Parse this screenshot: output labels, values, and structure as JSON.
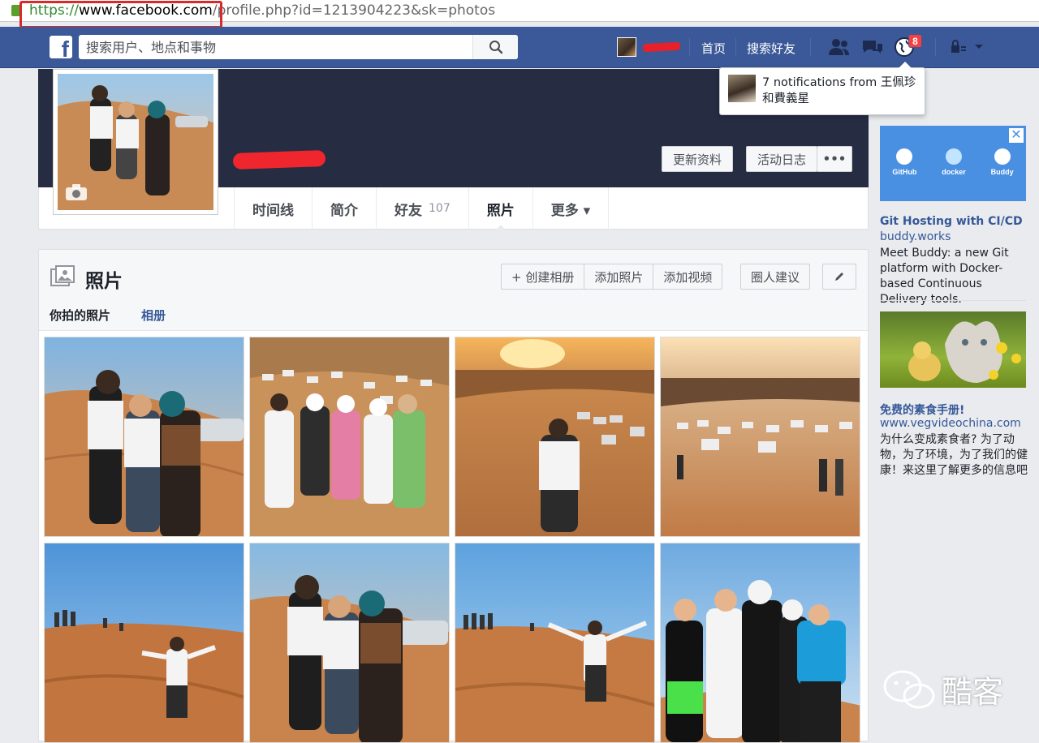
{
  "browser": {
    "url_protocol": "https://",
    "url_domain": "www.facebook.com",
    "url_path": "/profile.php?id=1213904223&sk=photos"
  },
  "header": {
    "search_placeholder": "搜索用户、地点和事物",
    "links": {
      "home": "首页",
      "find_friends": "搜索好友"
    },
    "notification_count": "8"
  },
  "notification_popup": {
    "text": "7 notifications from 王佩珍和費義星"
  },
  "cover": {
    "buttons": {
      "update_info": "更新资料",
      "activity_log": "活动日志",
      "more": "•••"
    }
  },
  "tabs": [
    {
      "label": "时间线"
    },
    {
      "label": "简介"
    },
    {
      "label": "好友",
      "count": "107"
    },
    {
      "label": "照片"
    },
    {
      "label": "更多 ▾"
    }
  ],
  "photos": {
    "title": "照片",
    "buttons": {
      "create_album": "+ 创建相册",
      "add_photos": "添加照片",
      "add_video": "添加视频",
      "tag_suggestions": "圈人建议"
    },
    "subtabs": {
      "your_photos": "你拍的照片",
      "albums": "相册"
    }
  },
  "ads": [
    {
      "logos": [
        "GitHub",
        "docker",
        "Buddy"
      ],
      "title": "Git Hosting with CI/CD T...",
      "domain": "buddy.works",
      "body": "Meet Buddy: a new Git platform with Docker-based Continuous Delivery tools."
    },
    {
      "title": "免费的素食手册!",
      "domain": "www.vegvideochina.com",
      "body": "为什么变成素食者? 为了动物，为了环境，为了我们的健康！来这里了解更多的信息吧"
    }
  ],
  "watermark": {
    "text": "酷客"
  },
  "colors": {
    "brand": "#3b5998",
    "link": "#365899",
    "notification": "#fa3e3e",
    "redaction": "#e8202a"
  }
}
